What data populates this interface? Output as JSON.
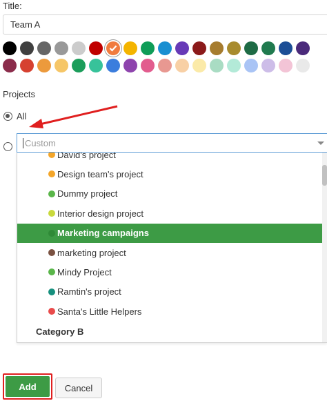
{
  "form": {
    "title_label": "Title:",
    "title_value": "Team A",
    "projects_label": "Projects"
  },
  "colors": {
    "row1": [
      "#000000",
      "#404040",
      "#666666",
      "#999999",
      "#cccccc",
      "#c00000",
      "#f07b3f",
      "#f4b400",
      "#0f9d58",
      "#1a8fd1",
      "#673ab7",
      "#8b1a1a",
      "#a67c2e",
      "#a88b2e",
      "#1e6b45",
      "#207a4f",
      "#1c4e96",
      "#4a2a7a"
    ],
    "row2": [
      "#8b2c4b",
      "#d64130",
      "#ec9a3c",
      "#f6c667",
      "#1b9d5a",
      "#37c29a",
      "#3b7ddd",
      "#8e44ad",
      "#e25c8e",
      "#e89891",
      "#f8d0a5",
      "#fbeaa8",
      "#a9dcc3",
      "#b3ead8",
      "#a9c4f5",
      "#cdbde8",
      "#f3c4d6",
      "#e9e9e9"
    ],
    "selected_index": 6
  },
  "projects": {
    "all_label": "All",
    "custom_placeholder": "Custom",
    "options": [
      {
        "label": "David's project",
        "color": "#f4a62a"
      },
      {
        "label": "Design team's project",
        "color": "#f4a62a"
      },
      {
        "label": "Dummy project",
        "color": "#5ab64a"
      },
      {
        "label": "Interior design project",
        "color": "#c9d93c"
      },
      {
        "label": "Marketing campaigns",
        "color": "#2f8a37"
      },
      {
        "label": "marketing project",
        "color": "#7a5141"
      },
      {
        "label": "Mindy Project",
        "color": "#5ab64a"
      },
      {
        "label": "Ramtin's project",
        "color": "#17907e"
      },
      {
        "label": "Santa's Little Helpers",
        "color": "#e94b4b"
      }
    ],
    "highlighted_index": 4,
    "category_label": "Category B"
  },
  "buttons": {
    "add_label": "Add",
    "cancel_label": "Cancel"
  }
}
